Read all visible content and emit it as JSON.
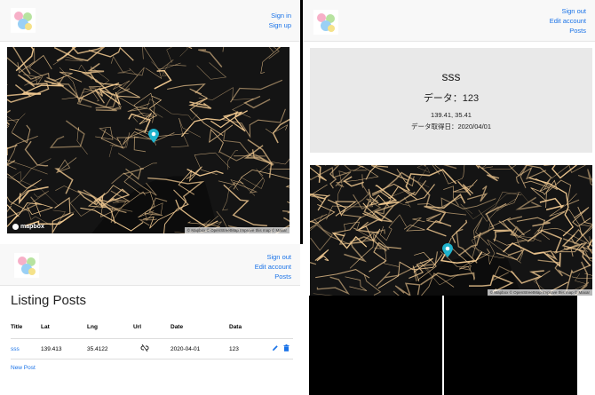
{
  "colors": {
    "link": "#1a73e8",
    "pin": "#1fb3cc",
    "map_bg": "#141414",
    "roads": "#f0c890",
    "card_bg": "#e9e9e9",
    "header_bg": "#f8f8f8"
  },
  "panel1": {
    "nav": {
      "sign_in": "Sign in",
      "sign_up": "Sign up"
    },
    "map": {
      "brand": "mapbox",
      "attribution": "© Mapbox © OpenStreetMap Improve this map © Maxar"
    }
  },
  "panel2": {
    "nav": {
      "sign_out": "Sign out",
      "edit_account": "Edit account",
      "posts": "Posts"
    },
    "title": "Listing Posts",
    "columns": [
      "Title",
      "Lat",
      "Lng",
      "Url",
      "Date",
      "Data"
    ],
    "rows": [
      {
        "title": "sss",
        "lat": "139.413",
        "lng": "35.4122",
        "url_icon": "link-broken-icon",
        "date": "2020-04-01",
        "data": "123",
        "edit_icon": "pencil-icon",
        "delete_icon": "trash-icon"
      }
    ],
    "new_post": "New Post"
  },
  "panel3": {
    "nav": {
      "sign_out": "Sign out",
      "edit_account": "Edit account",
      "posts": "Posts"
    },
    "post": {
      "title": "sss",
      "data_line": "データ：123",
      "coords": "139.41, 35.41",
      "date_line": "データ取得日：2020/04/01"
    },
    "map": {
      "attribution": "© Mapbox © OpenStreetMap Improve this map © Maxar"
    }
  }
}
